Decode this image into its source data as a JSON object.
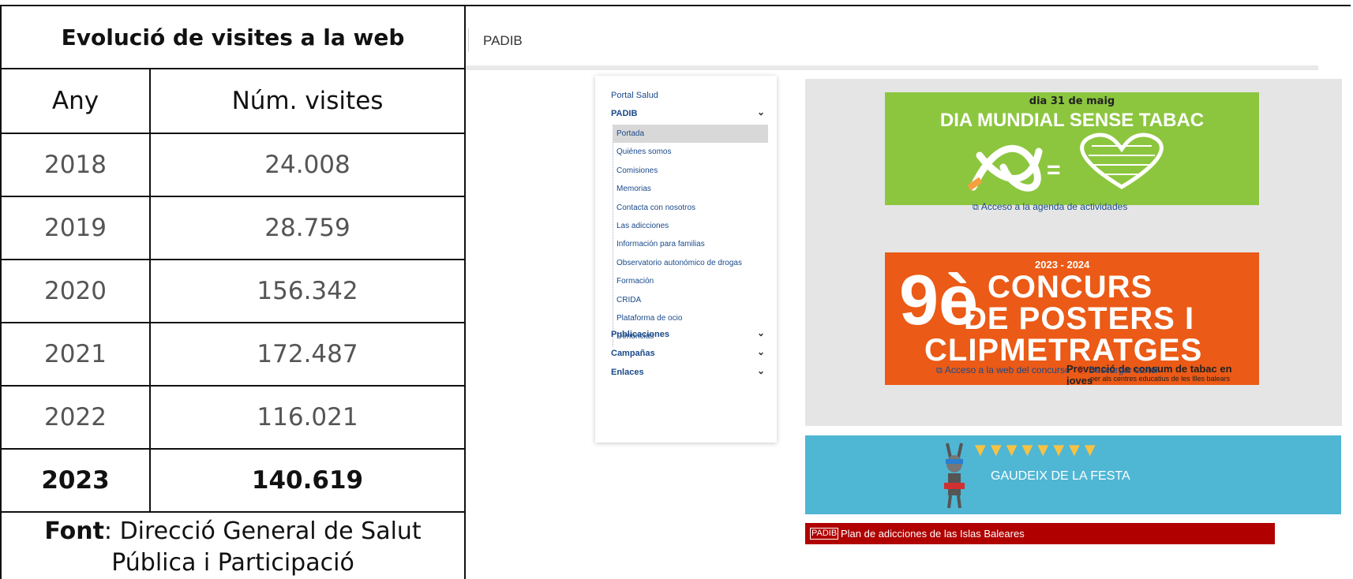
{
  "table": {
    "title": "Evolució de visites a la web",
    "col_year": "Any",
    "col_visits": "Núm. visites",
    "rows": [
      {
        "year": "2018",
        "visits": "24.008"
      },
      {
        "year": "2019",
        "visits": "28.759"
      },
      {
        "year": "2020",
        "visits": "156.342"
      },
      {
        "year": "2021",
        "visits": "172.487"
      },
      {
        "year": "2022",
        "visits": "116.021"
      },
      {
        "year": "2023",
        "visits": "140.619"
      }
    ],
    "source_label": "Font",
    "source_text": ": Direcció General de Salut Pública i Participació"
  },
  "screenshot": {
    "site_title": "PADIB",
    "sidebar": {
      "portal": "Portal Salud",
      "section_main": "PADIB",
      "items": [
        "Portada",
        "Quiénes somos",
        "Comisiones",
        "Memorias",
        "Contacta con nosotros",
        "Las adicciones",
        "Información para familias",
        "Observatorio autonómico de drogas",
        "Formación",
        "CRIDA",
        "Plataforma de ocio",
        "Denuncias"
      ],
      "active_item": "Portada",
      "section_publicaciones": "Publicaciones",
      "section_campanas": "Campañas",
      "section_enlaces": "Enlaces"
    },
    "banner1": {
      "date": "dia 31 de maig",
      "title": "DIA MUNDIAL SENSE TABAC",
      "link": "Acceso a la agenda de actividades"
    },
    "banner2": {
      "years": "2023 - 2024",
      "number": "9è",
      "line1": "CONCURS",
      "line2": "DE POSTERS I",
      "line3": "CLIPMETRATGES",
      "subtitle": "Prevenció de consum de tabac en joves",
      "subtitle2": "per als centres educatius de les Illes balears",
      "link_web": "Acceso a la web del concurso",
      "link_cartel": "Descargar cartel"
    },
    "banner3": {
      "text": "GAUDEIX DE LA FESTA"
    },
    "footer_bar": {
      "logo": "PADIB",
      "text": "Plan de adicciones de las Islas Baleares"
    },
    "colors": {
      "green": "#8cc63f",
      "orange": "#eb5a16",
      "blue": "#4fb6d4",
      "red": "#b00000",
      "link": "#1a4a8a"
    }
  }
}
